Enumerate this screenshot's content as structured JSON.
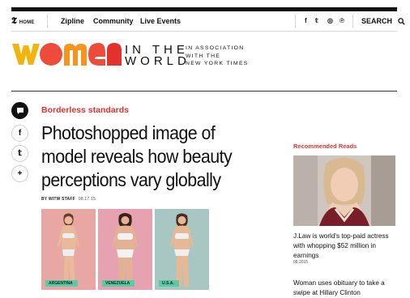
{
  "nav": {
    "home": "HOME",
    "links": [
      "Zipline",
      "Community",
      "Live Events"
    ],
    "social_icons": [
      "facebook-icon",
      "twitter-icon",
      "instagram-icon",
      "pinterest-icon"
    ],
    "social_glyphs": [
      "f",
      "𝕥",
      "◎",
      "℗"
    ],
    "search": "SEARCH",
    "nyt_glyph": "𝕿"
  },
  "logo": {
    "women": "women",
    "line1": "IN THE",
    "line2": "WORLD",
    "assoc1": "IN ASSOCIATION",
    "assoc2": "WITH THE",
    "assoc3": "NEW YORK TIMES",
    "colors": [
      "#f1b40f",
      "#ef4b3a",
      "#f7941d",
      "#ef4b3a",
      "#e3312d"
    ]
  },
  "share": {
    "icons": [
      "comment-icon",
      "facebook-icon",
      "twitter-icon",
      "plus-icon"
    ],
    "glyphs": [
      "",
      "f",
      "𝕥",
      "+"
    ]
  },
  "article": {
    "kicker": "Borderless standards",
    "headline": "Photoshopped image of model reveals how beauty perceptions vary globally",
    "author": "BY WITW STAFF",
    "date": "08.17.15",
    "photos": [
      {
        "label": "ARGENTINA",
        "bg": "#e9a7a3"
      },
      {
        "label": "VENEZUELA",
        "bg": "#e6a2b0"
      },
      {
        "label": "U.S.A.",
        "bg": "#a9c7c2"
      }
    ]
  },
  "sidebar": {
    "title": "Recommended Reads",
    "items": [
      {
        "headline": "J.Law is world's top-paid actress with whopping $52 million in earnings",
        "date": "08.2015"
      },
      {
        "headline": "Woman uses obituary to take a swipe at Hillary Clinton",
        "date": ""
      }
    ]
  },
  "accent": "#e3312d"
}
